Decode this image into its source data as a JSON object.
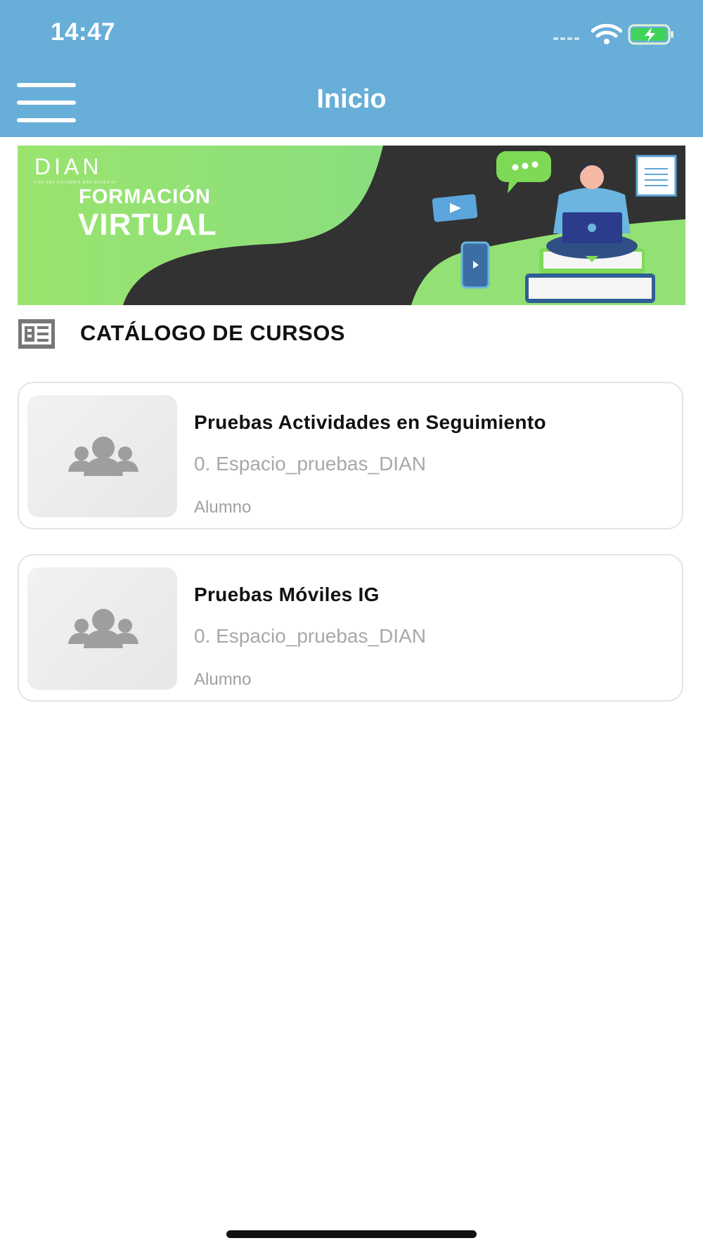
{
  "status_bar": {
    "time": "14:47"
  },
  "header": {
    "title": "Inicio",
    "menu_icon": "hamburger-menu-icon",
    "background_color": "#67aed8"
  },
  "banner": {
    "logo_text": "DIAN",
    "logo_tagline": "POR UNA COLOMBIA MÁS HONESTA",
    "line1": "FORMACIÓN",
    "line2": "VIRTUAL"
  },
  "catalog": {
    "icon": "catalog-list-icon",
    "title": "CATÁLOGO DE CURSOS"
  },
  "courses": [
    {
      "title": "Pruebas Actividades en Seguimiento",
      "category": "0. Espacio_pruebas_DIAN",
      "role": "Alumno",
      "thumbnail_icon": "group-placeholder-icon"
    },
    {
      "title": "Pruebas Móviles IG",
      "category": "0. Espacio_pruebas_DIAN",
      "role": "Alumno",
      "thumbnail_icon": "group-placeholder-icon"
    }
  ]
}
